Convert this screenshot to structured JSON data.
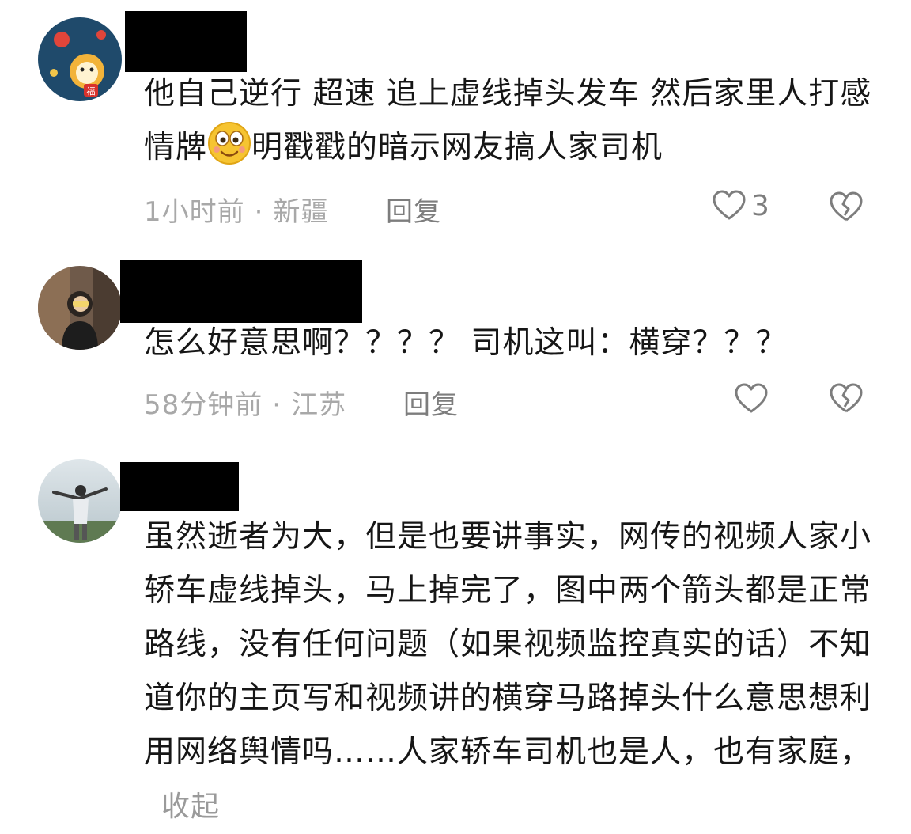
{
  "comments": [
    {
      "avatar_icon": "avatar-tiger-fu-icon",
      "text_before_emoji": "他自己逆行 超速 追上虚线掉头发车 然后家里人打感情牌",
      "emoji_icon": "wink-smile-emoji-icon",
      "text_after_emoji": "明戳戳的暗示网友搞人家司机",
      "time": "1小时前",
      "location": "新疆",
      "reply_label": "回复",
      "like_count": "3"
    },
    {
      "avatar_icon": "avatar-person-photo-icon",
      "text": "怎么好意思啊？？？？ 司机这叫：横穿？？？",
      "time": "58分钟前",
      "location": "江苏",
      "reply_label": "回复",
      "like_count": ""
    },
    {
      "avatar_icon": "avatar-landscape-photo-icon",
      "text": "虽然逝者为大，但是也要讲事实，网传的视频人家小轿车虚线掉头，马上掉完了，图中两个箭头都是正常路线，没有任何问题（如果视频监控真实的话）不知道你的主页写和视频讲的横穿马路掉头什么意思想利用网络舆情吗……人家轿车司机也是人，也有家庭，",
      "collapse_label": "收起"
    }
  ],
  "separator": "·",
  "colors": {
    "text": "#161616",
    "meta": "#a8a8a8",
    "action": "#7d7d7d",
    "redaction": "#000000"
  }
}
